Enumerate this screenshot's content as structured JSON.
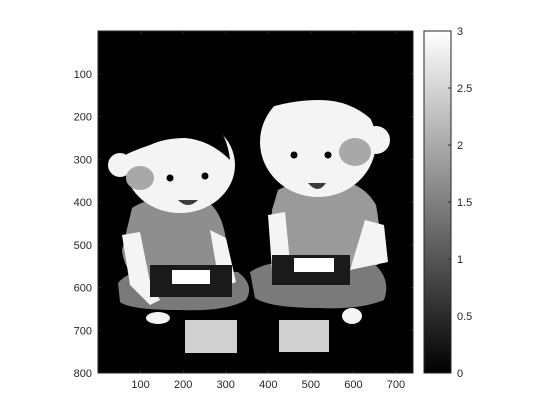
{
  "chart_data": [
    {
      "type": "heatmap",
      "title": "",
      "xlabel": "",
      "ylabel": "",
      "colormap": "gray",
      "xlim": [
        0,
        740
      ],
      "ylim": [
        800,
        0
      ],
      "xticks": [
        100,
        200,
        300,
        400,
        500,
        600,
        700
      ],
      "yticks": [
        100,
        200,
        300,
        400,
        500,
        600,
        700,
        800
      ],
      "clim": [
        0,
        3
      ],
      "colorbar_ticks": [
        0,
        0.5,
        1,
        1.5,
        2,
        2.5,
        3
      ],
      "colorbar_tick_labels": [
        "0",
        "0.5",
        "1",
        "1.5",
        "2",
        "2.5",
        "3"
      ],
      "background_value": 0,
      "content": "grayscale label image of two cartoon children sitting cross-legged playing handheld game consoles",
      "regions": [
        {
          "name": "left-child-face",
          "value": 3
        },
        {
          "name": "left-child-shirt",
          "value": 1.5
        },
        {
          "name": "left-child-legs",
          "value": 1
        },
        {
          "name": "left-child-console",
          "value": 0
        },
        {
          "name": "left-child-screen",
          "value": 3
        },
        {
          "name": "right-child-face",
          "value": 3
        },
        {
          "name": "right-child-shirt",
          "value": 1.5
        },
        {
          "name": "right-child-legs",
          "value": 1
        },
        {
          "name": "right-child-console",
          "value": 0
        },
        {
          "name": "right-child-screen",
          "value": 3
        },
        {
          "name": "floor-card-left",
          "value": 2.5
        },
        {
          "name": "floor-card-right",
          "value": 2.5
        }
      ]
    }
  ]
}
